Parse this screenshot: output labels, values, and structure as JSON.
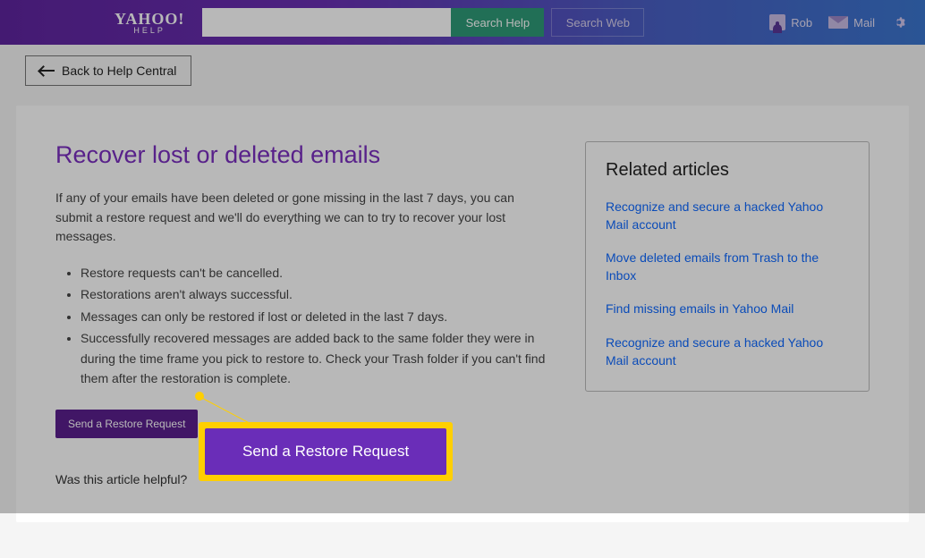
{
  "brand": {
    "name": "YAHOO!",
    "sub": "HELP"
  },
  "search": {
    "placeholder": "",
    "help_btn": "Search Help",
    "web_btn": "Search Web"
  },
  "user": {
    "name": "Rob",
    "mail_label": "Mail"
  },
  "back_label": "Back to Help Central",
  "article": {
    "title": "Recover lost or deleted emails",
    "intro": "If any of your emails have been deleted or gone missing in the last 7 days, you can submit a restore request and we'll do everything we can to try to recover your lost messages.",
    "bullets": [
      "Restore requests can't be cancelled.",
      "Restorations aren't always successful.",
      "Messages can only be restored if lost or deleted in the last 7 days.",
      "Successfully recovered messages are added back to the same folder they were in during the time frame you pick to restore to. Check your Trash folder if you can't find them after the restoration is complete."
    ],
    "restore_btn": "Send a Restore Request",
    "helpful_prompt": "Was this article helpful?"
  },
  "related": {
    "heading": "Related articles",
    "links": [
      "Recognize and secure a hacked Yahoo Mail account",
      "Move deleted emails from Trash to the Inbox",
      "Find missing emails in Yahoo Mail",
      "Recognize and secure a hacked Yahoo Mail account"
    ]
  },
  "callout_btn": "Send a Restore Request"
}
